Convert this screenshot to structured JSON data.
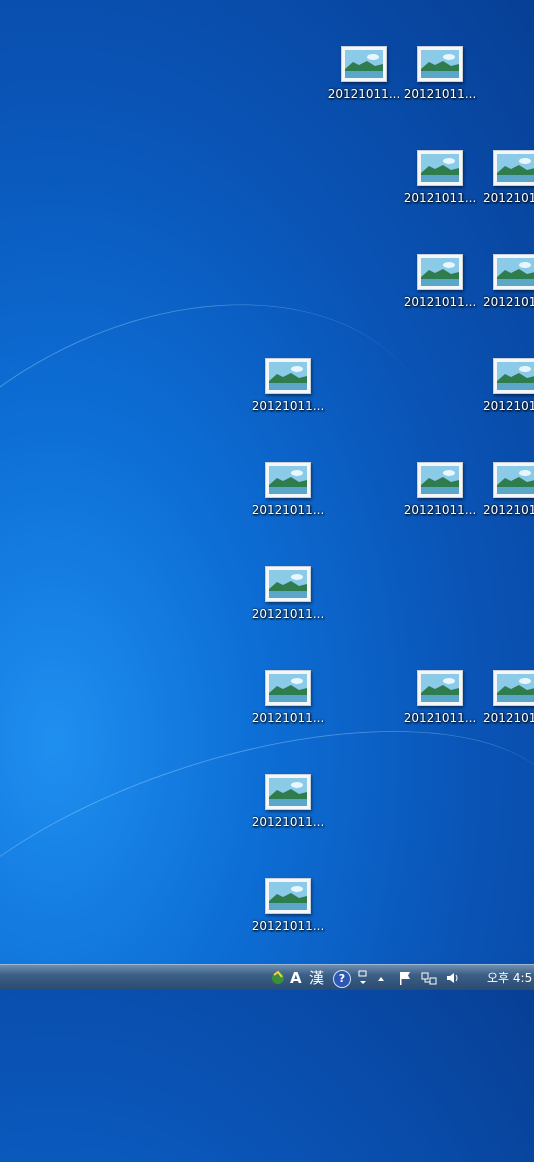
{
  "desktop": {
    "icon_label": "20121011...",
    "icon_label_cut": "2012101",
    "icons": [
      {
        "label": "20121011..."
      },
      {
        "label": "20121011..."
      },
      {
        "label": "20121011..."
      },
      {
        "label": "2012101"
      },
      {
        "label": "20121011..."
      },
      {
        "label": "2012101"
      },
      {
        "label": "20121011..."
      },
      {
        "label": "2012101"
      },
      {
        "label": "20121011..."
      },
      {
        "label": "20121011..."
      },
      {
        "label": "2012101"
      },
      {
        "label": "20121011..."
      },
      {
        "label": "20121011..."
      },
      {
        "label": "20121011..."
      },
      {
        "label": "2012101"
      },
      {
        "label": "20121011..."
      },
      {
        "label": "20121011..."
      }
    ]
  },
  "taskbar": {
    "ime_mode": "A",
    "ime_hanja": "漢",
    "help_glyph": "?",
    "clock_text": "오후 4:5"
  }
}
